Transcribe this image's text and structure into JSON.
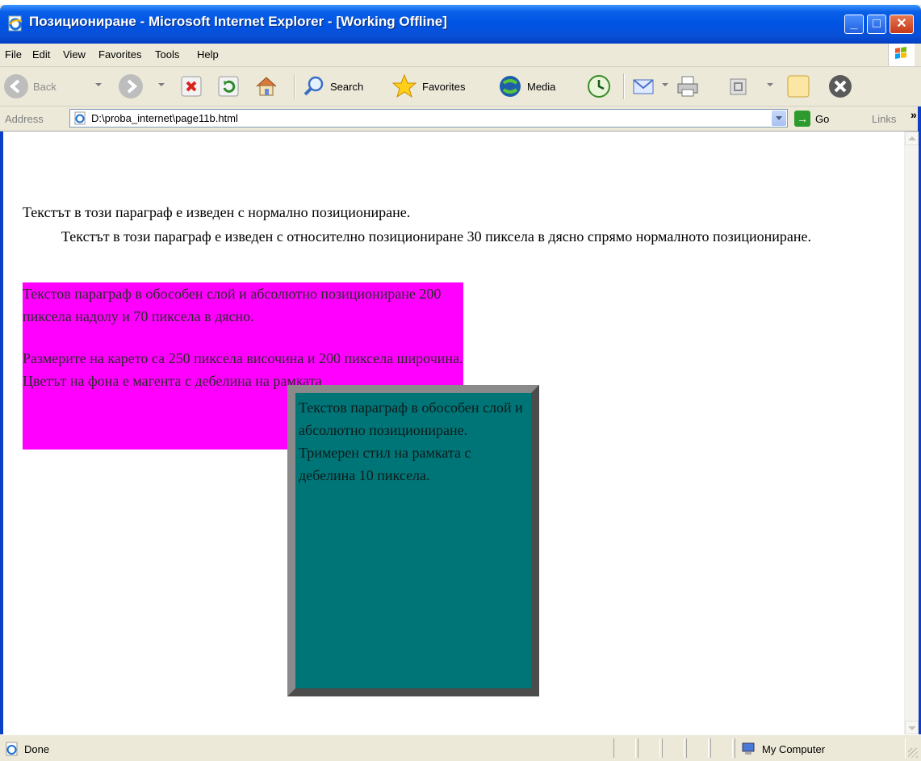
{
  "window": {
    "title": "Позициониране - Microsoft Internet Explorer - [Working Offline]",
    "minimize_glyph": "_",
    "maximize_glyph": "□",
    "close_glyph": "✕"
  },
  "menu": {
    "items": [
      "File",
      "Edit",
      "View",
      "Favorites",
      "Tools",
      "Help"
    ]
  },
  "toolbar": {
    "back_label": "Back",
    "search_label": "Search",
    "favorites_label": "Favorites",
    "media_label": "Media"
  },
  "address": {
    "label": "Address",
    "value": "D:\\proba_internet\\page11b.html",
    "go_label": "Go",
    "links_label": "Links",
    "links_chevron": "»"
  },
  "content": {
    "p1": "Текстът в този параграф е изведен с нормално позициониране.",
    "p2": "Текстът в този параграф е изведен с относително позициониране 30 пиксела в дясно спрямо нормалното позициониране.",
    "magenta_p1": "Текстов параграф в обособен слой и абсолютно позициониране 200 пиксела надолу и 70 пиксела в дясно.",
    "magenta_p2": "Размерите на карето са 250 пиксела височина и 200 пиксела широчина. Цветът на фона е магента с дебелина на рамката",
    "teal_p": "Текстов параграф в обособен слой и абсолютно позициониране. Тримерен стил на рамката с дебелина 10 пиксела."
  },
  "status": {
    "text": "Done",
    "zone": "My Computer"
  },
  "colors": {
    "titlebar": "#0054e3",
    "magenta_box": "#ff00ff",
    "teal_box": "#007577",
    "teal_border": "#8a8a8a"
  },
  "icons": [
    "ie-page-icon",
    "back-icon",
    "forward-icon",
    "stop-icon",
    "refresh-icon",
    "home-icon",
    "search-icon",
    "favorites-star-icon",
    "media-icon",
    "history-icon",
    "mail-icon",
    "print-icon",
    "edit-icon",
    "notes-icon",
    "messenger-icon",
    "go-arrow-icon",
    "my-computer-icon",
    "windows-logo-icon"
  ]
}
